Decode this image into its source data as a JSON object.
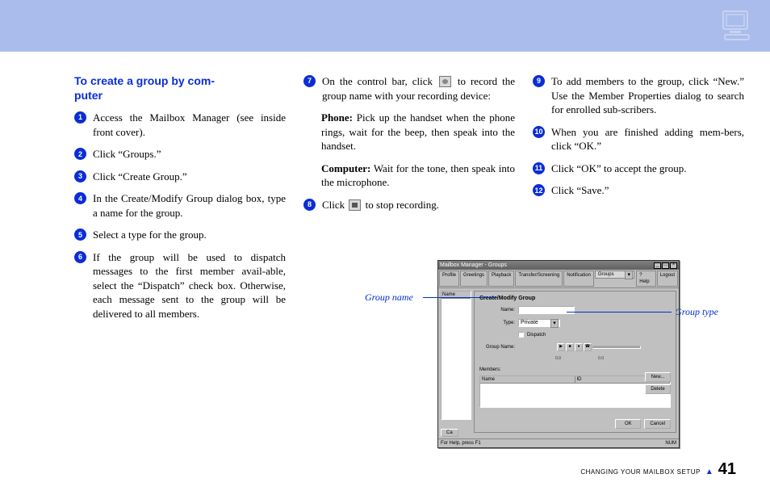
{
  "header": {
    "icon": "computer-monitor-icon"
  },
  "section_title": "To create a group by com-\nputer",
  "steps": {
    "s1": "Access the Mailbox Manager (see inside front cover).",
    "s2": "Click “Groups.”",
    "s3": "Click “Create Group.”",
    "s4": "In the Create/Modify Group dialog box, type a name for the group.",
    "s5": "Select a type for the group.",
    "s6": "If the group will be used to dispatch messages to the first member avail-able, select the “Dispatch” check box. Otherwise, each message sent to the group will be delivered to all members.",
    "s7_pre": "On the control bar, click ",
    "s7_post": " to record the group name with your recording device:",
    "s7_phone_label": "Phone:",
    "s7_phone_text": " Pick up the handset when the phone rings, wait for the beep, then speak into the handset.",
    "s7_comp_label": "Computer:",
    "s7_comp_text": " Wait for the tone, then speak into the microphone.",
    "s8_pre": "Click ",
    "s8_post": " to stop recording.",
    "s9": "To add members to the group, click “New.” Use the Member Properties dialog to search for enrolled sub-scribers.",
    "s10": "When you are finished adding mem-bers, click “OK.”",
    "s11": "Click “OK” to accept the group.",
    "s12": "Click “Save.”"
  },
  "callouts": {
    "left": "Group name",
    "right": "Group type"
  },
  "window": {
    "title": "Mailbox Manager - Groups",
    "menu": [
      "Profile",
      "Greetings",
      "Playback",
      "Transfer/Screening",
      "Notification",
      "Groups"
    ],
    "menu_right": [
      "Help",
      "Logout"
    ],
    "list_header": "Name",
    "dlg_title": "Create/Modify Group",
    "name_label": "Name:",
    "type_label": "Type:",
    "type_value": "Private",
    "dispatch_label": "Dispatch",
    "groupname_label": "Group Name:",
    "time_start": "0.0",
    "time_end": "0.0",
    "members_label": "Members:",
    "members_cols": [
      "Name",
      "ID"
    ],
    "btn_new": "New...",
    "btn_delete": "Delete",
    "btn_ok": "OK",
    "btn_cancel": "Cancel",
    "outer_cancel": "Ca",
    "status": "For Help, press F1",
    "status_right": "NUM"
  },
  "footer": {
    "label": "CHANGING YOUR MAILBOX SETUP",
    "page": "41"
  }
}
